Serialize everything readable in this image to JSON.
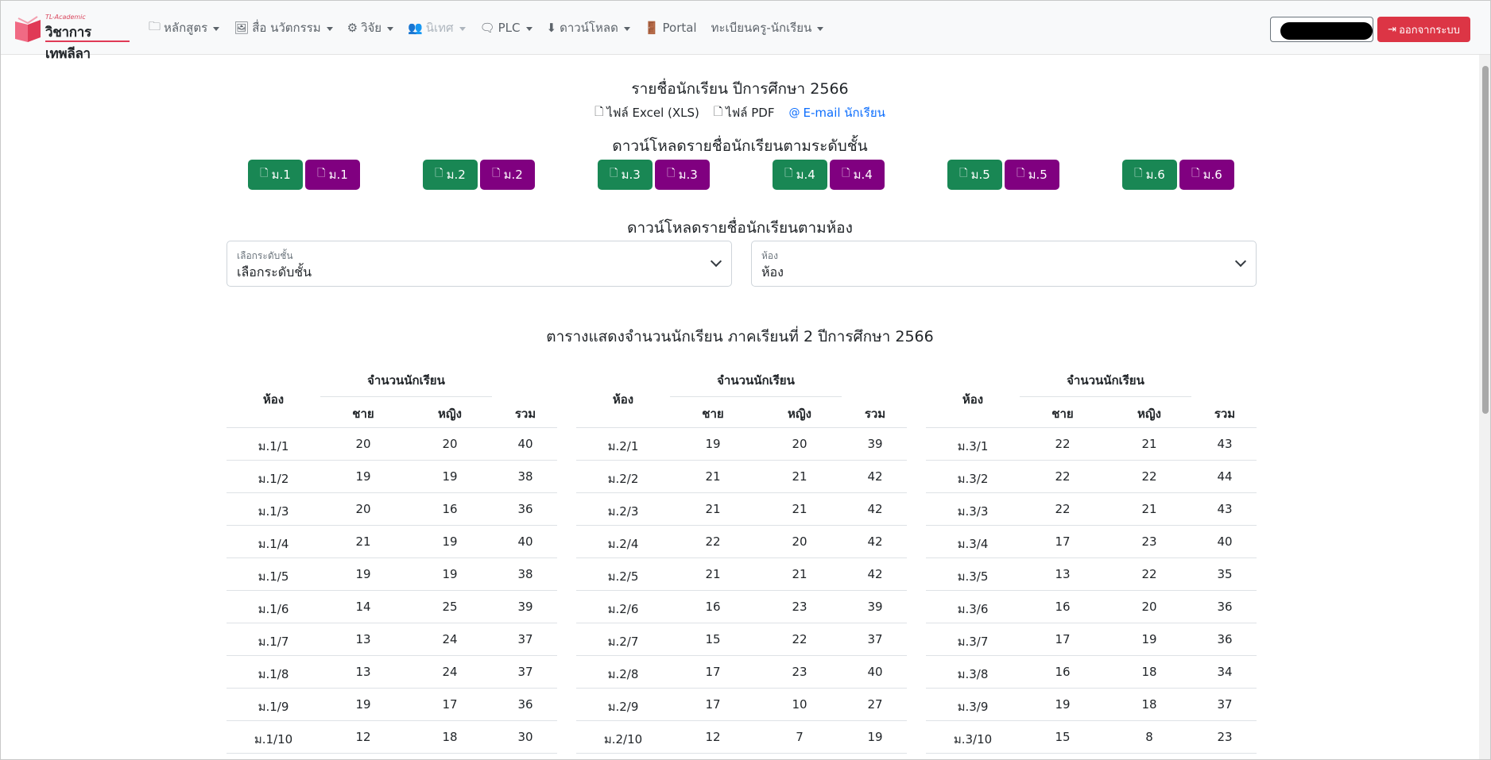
{
  "navbar": {
    "brand_small": "TL-Academic",
    "brand_main": "วิชาการเทพลีลา",
    "items": [
      {
        "label": "หลักสูตร",
        "icon": "folder-icon",
        "glyph": "🗀",
        "disabled": false
      },
      {
        "label": "สื่อ นวัตกรรม",
        "icon": "images-icon",
        "glyph": "🖼",
        "disabled": false
      },
      {
        "label": "วิจัย",
        "icon": "gear-icon",
        "glyph": "⚙",
        "disabled": false
      },
      {
        "label": "นิเทศ",
        "icon": "people-icon",
        "glyph": "👥",
        "disabled": true
      },
      {
        "label": "PLC",
        "icon": "chat-icon",
        "glyph": "🗨",
        "disabled": false
      },
      {
        "label": "ดาวน์โหลด",
        "icon": "download-icon",
        "glyph": "⬇",
        "disabled": false
      },
      {
        "label": "Portal",
        "icon": "door-icon",
        "glyph": "🚪",
        "disabled": false
      },
      {
        "label": "ทะเบียนครู-นักเรียน",
        "icon": "",
        "glyph": "",
        "disabled": false
      }
    ],
    "logout_label": "ออกจากระบบ",
    "logout_icon": "logout-icon"
  },
  "page": {
    "title": "รายชื่อนักเรียน ปีการศึกษา 2566",
    "links": [
      {
        "label": "ไฟล์ Excel (XLS)",
        "icon": "file-icon",
        "glyph": "🗋"
      },
      {
        "label": "ไฟล์ PDF",
        "icon": "file-icon",
        "glyph": "🗋"
      },
      {
        "label": "E-mail นักเรียน",
        "icon": "at-icon",
        "glyph": "@"
      }
    ],
    "level_heading": "ดาวน์โหลดรายชื่อนักเรียนตามระดับชั้น",
    "levels": [
      "ม.1",
      "ม.2",
      "ม.3",
      "ม.4",
      "ม.5",
      "ม.6"
    ],
    "room_heading": "ดาวน์โหลดรายชื่อนักเรียนตามห้อง",
    "select_level": {
      "label": "เลือกระดับชั้น",
      "value": "เลือกระดับชั้น"
    },
    "select_room": {
      "label": "ห้อง",
      "value": "ห้อง"
    },
    "table_title": "ตารางแสดงจำนวนนักเรียน ภาคเรียนที่ 2 ปีการศึกษา 2566"
  },
  "table_headers": {
    "room": "ห้อง",
    "count": "จำนวนนักเรียน",
    "male": "ชาย",
    "female": "หญิง",
    "total": "รวม"
  },
  "tables": [
    {
      "rows": [
        [
          "ม.1/1",
          "20",
          "20",
          "40"
        ],
        [
          "ม.1/2",
          "19",
          "19",
          "38"
        ],
        [
          "ม.1/3",
          "20",
          "16",
          "36"
        ],
        [
          "ม.1/4",
          "21",
          "19",
          "40"
        ],
        [
          "ม.1/5",
          "19",
          "19",
          "38"
        ],
        [
          "ม.1/6",
          "14",
          "25",
          "39"
        ],
        [
          "ม.1/7",
          "13",
          "24",
          "37"
        ],
        [
          "ม.1/8",
          "13",
          "24",
          "37"
        ],
        [
          "ม.1/9",
          "19",
          "17",
          "36"
        ],
        [
          "ม.1/10",
          "12",
          "18",
          "30"
        ]
      ]
    },
    {
      "rows": [
        [
          "ม.2/1",
          "19",
          "20",
          "39"
        ],
        [
          "ม.2/2",
          "21",
          "21",
          "42"
        ],
        [
          "ม.2/3",
          "21",
          "21",
          "42"
        ],
        [
          "ม.2/4",
          "22",
          "20",
          "42"
        ],
        [
          "ม.2/5",
          "21",
          "21",
          "42"
        ],
        [
          "ม.2/6",
          "16",
          "23",
          "39"
        ],
        [
          "ม.2/7",
          "15",
          "22",
          "37"
        ],
        [
          "ม.2/8",
          "17",
          "23",
          "40"
        ],
        [
          "ม.2/9",
          "17",
          "10",
          "27"
        ],
        [
          "ม.2/10",
          "12",
          "7",
          "19"
        ]
      ]
    },
    {
      "rows": [
        [
          "ม.3/1",
          "22",
          "21",
          "43"
        ],
        [
          "ม.3/2",
          "22",
          "22",
          "44"
        ],
        [
          "ม.3/3",
          "22",
          "21",
          "43"
        ],
        [
          "ม.3/4",
          "17",
          "23",
          "40"
        ],
        [
          "ม.3/5",
          "13",
          "22",
          "35"
        ],
        [
          "ม.3/6",
          "16",
          "20",
          "36"
        ],
        [
          "ม.3/7",
          "17",
          "19",
          "36"
        ],
        [
          "ม.3/8",
          "16",
          "18",
          "34"
        ],
        [
          "ม.3/9",
          "19",
          "18",
          "37"
        ],
        [
          "ม.3/10",
          "15",
          "8",
          "23"
        ]
      ]
    }
  ]
}
